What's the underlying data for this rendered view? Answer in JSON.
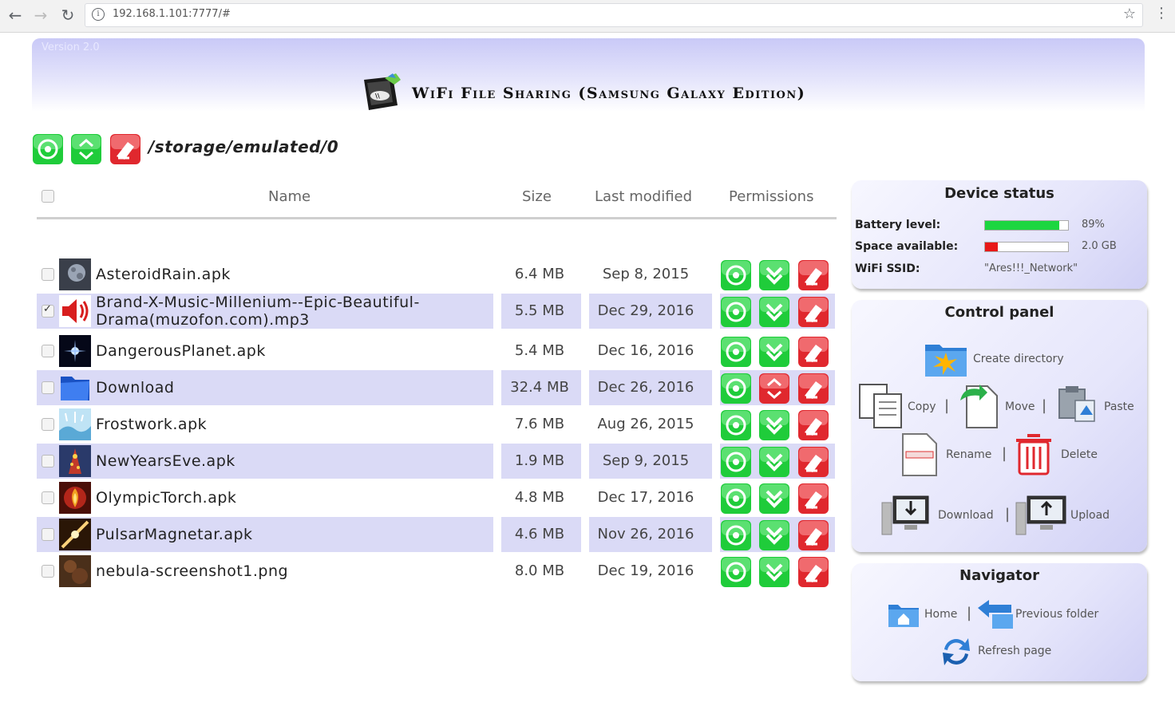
{
  "browser": {
    "url": "192.168.1.101:7777/#"
  },
  "header": {
    "version": "Version 2.0",
    "title": "WiFi File Sharing (Samsung Galaxy Edition)"
  },
  "current_path": "/storage/emulated/0",
  "table": {
    "columns": [
      "Name",
      "Size",
      "Last modified",
      "Permissions"
    ],
    "rows": [
      {
        "name": "AsteroidRain.apk",
        "size": "6.4 MB",
        "modified": "Sep 8, 2015",
        "checked": false,
        "icon": "app-icon-asteroid",
        "kind": "file"
      },
      {
        "name": "Brand-X-Music-Millenium--Epic-Beautiful-Drama(muzofon.com).mp3",
        "size": "5.5 MB",
        "modified": "Dec 29, 2016",
        "checked": true,
        "icon": "speaker-icon",
        "kind": "file"
      },
      {
        "name": "DangerousPlanet.apk",
        "size": "5.4 MB",
        "modified": "Dec 16, 2016",
        "checked": false,
        "icon": "app-icon-planet",
        "kind": "file"
      },
      {
        "name": "Download",
        "size": "32.4 MB",
        "modified": "Dec 26, 2016",
        "checked": false,
        "icon": "folder-icon",
        "kind": "folder"
      },
      {
        "name": "Frostwork.apk",
        "size": "7.6 MB",
        "modified": "Aug 26, 2015",
        "checked": false,
        "icon": "app-icon-frost",
        "kind": "file"
      },
      {
        "name": "NewYearsEve.apk",
        "size": "1.9 MB",
        "modified": "Sep 9, 2015",
        "checked": false,
        "icon": "app-icon-newyear",
        "kind": "file"
      },
      {
        "name": "OlympicTorch.apk",
        "size": "4.8 MB",
        "modified": "Dec 17, 2016",
        "checked": false,
        "icon": "app-icon-torch",
        "kind": "file"
      },
      {
        "name": "PulsarMagnetar.apk",
        "size": "4.6 MB",
        "modified": "Nov 26, 2016",
        "checked": false,
        "icon": "app-icon-pulsar",
        "kind": "file"
      },
      {
        "name": "nebula-screenshot1.png",
        "size": "8.0 MB",
        "modified": "Dec 19, 2016",
        "checked": false,
        "icon": "image-icon",
        "kind": "file"
      }
    ]
  },
  "device_status": {
    "title": "Device status",
    "battery_label": "Battery level:",
    "battery_value": "89%",
    "battery_fraction": 0.89,
    "space_label": "Space available:",
    "space_value": "2.0 GB",
    "space_fraction": 0.15,
    "ssid_label": "WiFi SSID:",
    "ssid_value": "\"Ares!!!_Network\""
  },
  "control_panel": {
    "title": "Control panel",
    "create_directory": "Create directory",
    "copy": "Copy",
    "move": "Move",
    "paste": "Paste",
    "rename": "Rename",
    "delete": "Delete",
    "download": "Download",
    "upload": "Upload"
  },
  "navigator": {
    "title": "Navigator",
    "home": "Home",
    "previous_folder": "Previous folder",
    "refresh_page": "Refresh page"
  },
  "colors": {
    "green_button": "#1fcc3a",
    "red_button": "#e0282e",
    "row_alt": "#dadaf6",
    "battery_fill": "#1cd640",
    "space_fill": "#e81818"
  }
}
